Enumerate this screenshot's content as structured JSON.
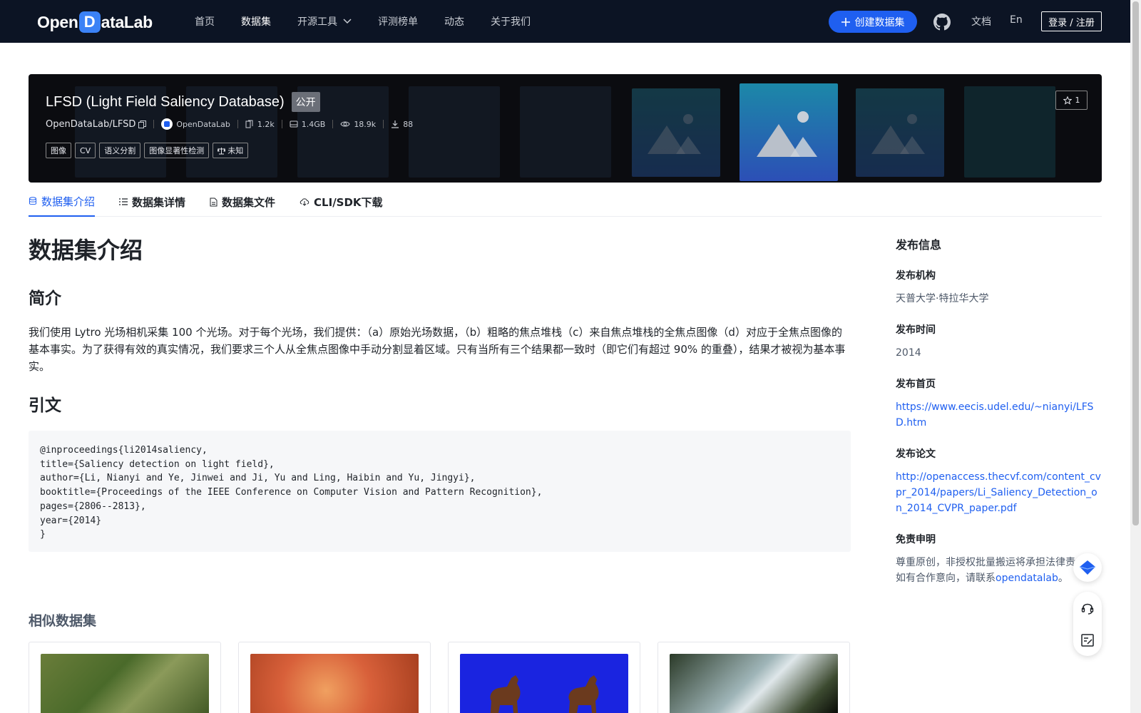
{
  "nav": {
    "logo": {
      "prefix": "Open",
      "mark": "D",
      "suffix": "ataLab"
    },
    "items": [
      "首页",
      "数据集",
      "开源工具",
      "评测榜单",
      "动态",
      "关于我们"
    ],
    "create_button": "创建数据集",
    "docs": "文档",
    "language": "En",
    "login": "登录 / 注册"
  },
  "dataset": {
    "title": "LFSD (Light Field Saliency Database)",
    "visibility": "公开",
    "repo": "OpenDataLab/LFSD",
    "publisher": "OpenDataLab",
    "stats": {
      "files": "1.2k",
      "size": "1.4GB",
      "views": "18.9k",
      "downloads": "88"
    },
    "tags": [
      "图像",
      "CV",
      "语义分割",
      "图像显著性检测",
      "未知"
    ],
    "stars": "1"
  },
  "tabs": [
    "数据集介绍",
    "数据集详情",
    "数据集文件",
    "CLI/SDK下载"
  ],
  "content": {
    "title": "数据集介绍",
    "intro_heading": "简介",
    "intro_text": "我们使用 Lytro 光场相机采集 100 个光场。对于每个光场，我们提供：（a）原始光场数据，（b）粗略的焦点堆栈（c）来自焦点堆栈的全焦点图像（d）对应于全焦点图像的基本事实。为了获得有效的真实情况，我们要求三个人从全焦点图像中手动分割显着区域。只有当所有三个结果都一致时（即它们有超过 90% 的重叠），结果才被视为基本事实。",
    "citation_heading": "引文",
    "citation": "@inproceedings{li2014saliency,\ntitle={Saliency detection on light field},\nauthor={Li, Nianyi and Ye, Jinwei and Ji, Yu and Ling, Haibin and Yu, Jingyi},\nbooktitle={Proceedings of the IEEE Conference on Computer Vision and Pattern Recognition},\npages={2806--2813},\nyear={2014}\n}",
    "similar_heading": "相似数据集"
  },
  "sidebar": {
    "heading": "发布信息",
    "org_label": "发布机构",
    "org_value": "天普大学·特拉华大学",
    "time_label": "发布时间",
    "time_value": "2014",
    "homepage_label": "发布首页",
    "homepage_value": "https://www.eecis.udel.edu/~nianyi/LFSD.htm",
    "paper_label": "发布论文",
    "paper_value": "http://openaccess.thecvf.com/content_cvpr_2014/papers/Li_Saliency_Detection_on_2014_CVPR_paper.pdf",
    "disclaimer_label": "免责申明",
    "disclaimer_text": "尊重原创，非授权批量搬运将承担法律责任。如有合作意向，请联系",
    "disclaimer_link": "opendatalab",
    "disclaimer_end": "。"
  },
  "colors": {
    "nav_bg": "#0c1424",
    "accent": "#1f5ff0",
    "banner_bg": "#0b0c10"
  }
}
